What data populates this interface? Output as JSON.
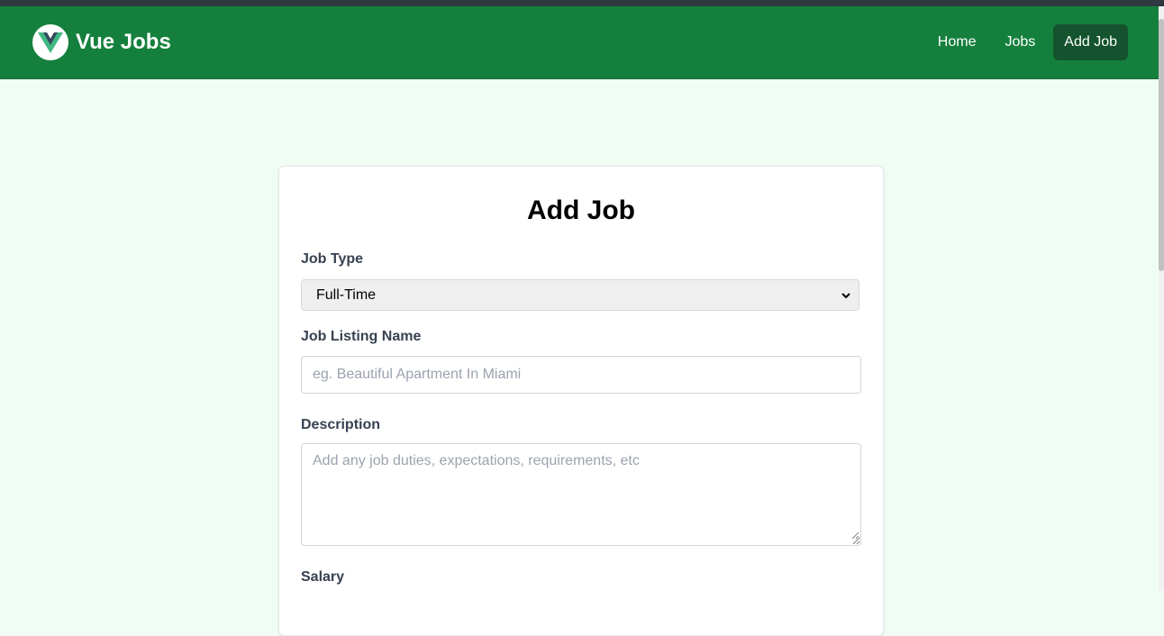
{
  "brand": {
    "name": "Vue Jobs"
  },
  "nav": {
    "items": [
      {
        "label": "Home"
      },
      {
        "label": "Jobs"
      },
      {
        "label": "Add Job"
      }
    ]
  },
  "form": {
    "title": "Add Job",
    "job_type": {
      "label": "Job Type",
      "value": "Full-Time"
    },
    "listing_name": {
      "label": "Job Listing Name",
      "placeholder": "eg. Beautiful Apartment In Miami",
      "value": ""
    },
    "description": {
      "label": "Description",
      "placeholder": "Add any job duties, expectations, requirements, etc",
      "value": ""
    },
    "salary": {
      "label": "Salary"
    }
  },
  "colors": {
    "nav_bg": "#15803d",
    "active_bg": "#14532d",
    "page_bg": "#f0fdf4"
  },
  "icons": {
    "logo": "vue-logo-icon",
    "select": "chevron-down-icon"
  }
}
